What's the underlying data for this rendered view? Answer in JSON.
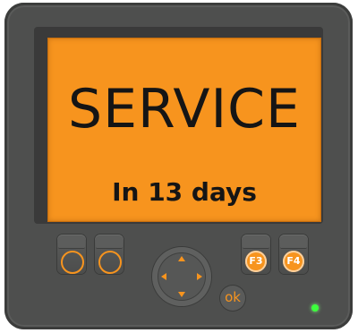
{
  "display": {
    "title": "SERVICE",
    "subtitle": "In 13 days",
    "background_color": "#f7941e",
    "text_color": "#151515"
  },
  "softkeys": [
    {
      "label": "",
      "icon": "circle-icon"
    },
    {
      "label": "",
      "icon": "circle-icon"
    },
    {
      "label": "F3",
      "icon": "f3-key-icon"
    },
    {
      "label": "F4",
      "icon": "f4-key-icon"
    }
  ],
  "navigation": {
    "arrows": [
      "up-arrow-icon",
      "down-arrow-icon",
      "left-arrow-icon",
      "right-arrow-icon"
    ],
    "ok_label": "ok"
  },
  "status_led": {
    "color": "#3cff3c",
    "state": "on"
  },
  "colors": {
    "accent": "#f7941e",
    "housing": "#4e4f4e"
  }
}
